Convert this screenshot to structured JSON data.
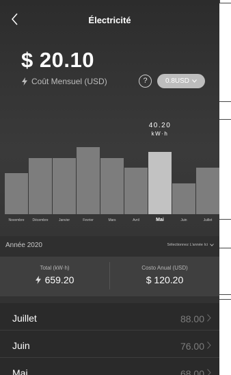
{
  "header": {
    "title": "Électricité"
  },
  "cost": {
    "value": "$ 20.10",
    "label": "Coût Mensuel (USD)"
  },
  "rate": {
    "label": "0.8USD"
  },
  "help": {
    "label": "?"
  },
  "chart_data": {
    "type": "bar",
    "unit": "kW·h",
    "categories": [
      "Novembre",
      "Décembre",
      "Janvier",
      "Fevrier",
      "Mars",
      "Avril",
      "Mai",
      "Juin",
      "Juillet"
    ],
    "values": [
      52,
      71,
      71,
      85,
      71,
      59,
      79,
      39,
      59
    ],
    "selected_index": 6,
    "selected_label_value": "40.20",
    "selected_label_unit": "kW·h"
  },
  "year": {
    "label": "Année 2020",
    "select_label": "Sélectionnez L'année Ici"
  },
  "totals": {
    "total_label": "Total (kW·h)",
    "total_value": "659.20",
    "annual_label": "Costo Anual (USD)",
    "annual_value": "$ 120.20"
  },
  "list": [
    {
      "month": "Juillet",
      "value": "88.00"
    },
    {
      "month": "Juin",
      "value": "76.00"
    },
    {
      "month": "Mai",
      "value": "68.00"
    }
  ],
  "colors": {
    "bar": "#7d7d7d",
    "bar_selected": "#c2c2c2",
    "rate_pill": "#bdbdbd",
    "background": "#333333"
  }
}
